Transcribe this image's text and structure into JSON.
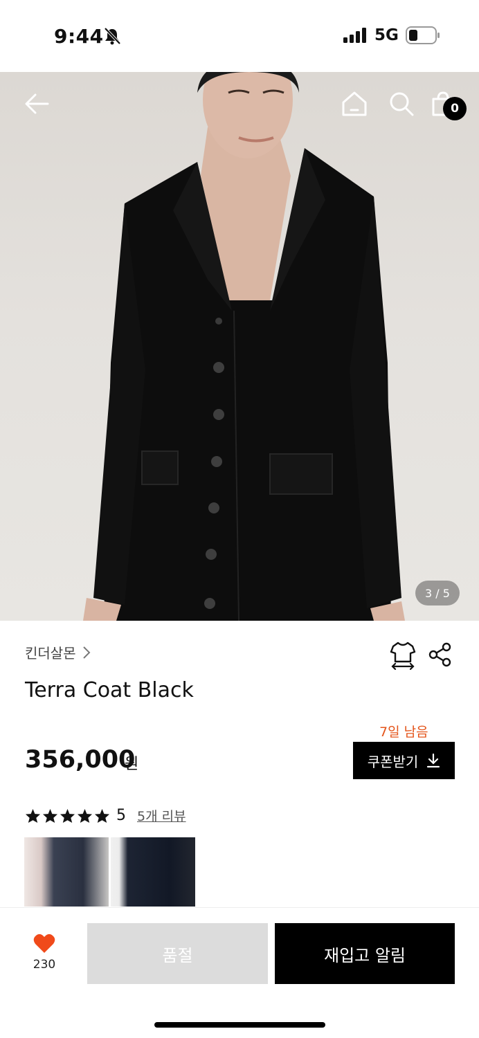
{
  "status_bar": {
    "time": "9:44",
    "network": "5G",
    "icons": [
      "bell-slash-icon",
      "signal-icon",
      "battery-icon"
    ]
  },
  "hero": {
    "icons": [
      "back-arrow-icon",
      "home-icon",
      "search-icon",
      "shopping-bag-icon"
    ],
    "cart_count": "0",
    "pager": "3 / 5"
  },
  "product": {
    "brand": "킨더살몬",
    "title": "Terra Coat Black",
    "price": "356,000",
    "price_unit": "원",
    "coupon_days_left": "7일 남음",
    "coupon_button": "쿠폰받기",
    "rating_stars": 5,
    "rating_value": "5",
    "review_link": "5개 리뷰",
    "icons": [
      "size-guide-shirt-icon",
      "share-icon",
      "chevron-right-icon",
      "download-icon",
      "star-icon"
    ]
  },
  "bottom_bar": {
    "like_count": "230",
    "soldout_label": "품절",
    "restock_label": "재입고 알림",
    "icons": [
      "heart-icon"
    ]
  },
  "colors": {
    "accent_orange": "#e4541a",
    "heart": "#f04a1a",
    "primary": "#000000",
    "disabled": "#dcdcdc"
  }
}
